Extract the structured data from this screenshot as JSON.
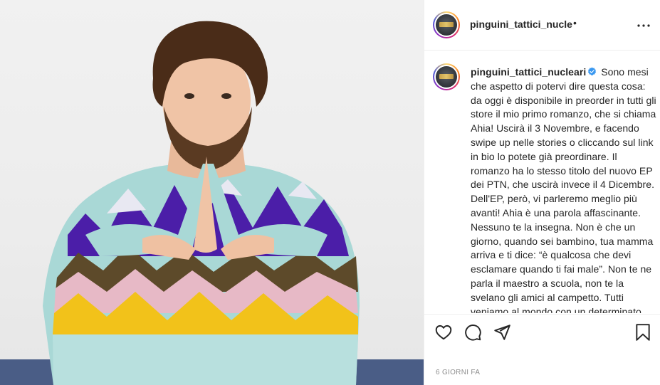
{
  "post": {
    "photo_alt": "",
    "header": {
      "username": "pinguini_tattici_nucle",
      "dot": "•",
      "more_icon": "more-horizontal-icon"
    },
    "caption": {
      "username": "pinguini_tattici_nucleari",
      "verified_icon": "verified-badge-icon",
      "text": "Sono mesi che aspetto di potervi dire questa cosa: da oggi è disponibile in preorder in tutti gli store il mio primo romanzo, che si chiama Ahia! Uscirà il 3 Novembre, e facendo swipe up nelle stories o cliccando sul link in bio lo potete già preordinare. Il romanzo ha lo stesso titolo del nuovo EP dei PTN, che uscirà invece il 4 Dicembre. Dell'EP, però, vi parleremo meglio più avanti! Ahia è una parola affascinante. Nessuno te la insegna. Non è che un giorno, quando sei bambino, tua mamma arriva e ti dice: “è qualcosa che devi esclamare quando ti fai male”. Non te ne parla il maestro a scuola, non te la svelano gli amici al campetto. Tutti veniamo al mondo con un determinato numero di"
    },
    "actions": {
      "like_icon": "heart-icon",
      "comment_icon": "comment-icon",
      "share_icon": "share-icon",
      "save_icon": "bookmark-icon"
    },
    "timestamp": "6 giorni fa"
  },
  "colors": {
    "verified_blue": "#3897f0",
    "text": "#262626",
    "muted": "#8e8e8e",
    "border": "#efefef"
  }
}
